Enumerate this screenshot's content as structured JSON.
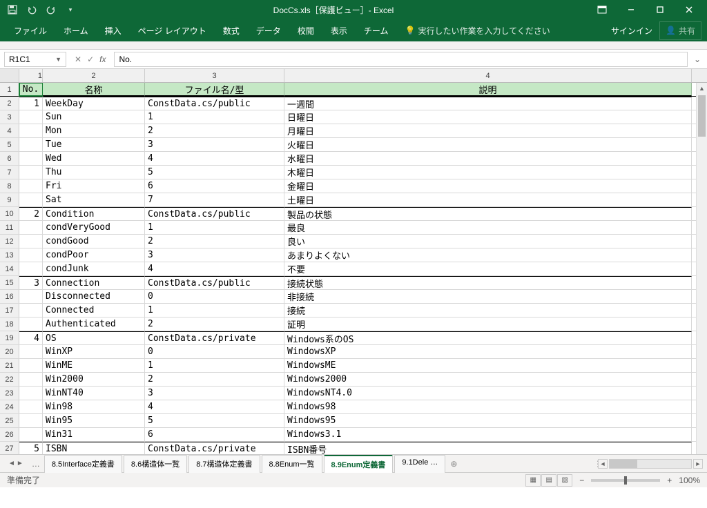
{
  "title": "DocCs.xls［保護ビュー］- Excel",
  "ribbon": {
    "tabs": [
      "ファイル",
      "ホーム",
      "挿入",
      "ページ レイアウト",
      "数式",
      "データ",
      "校閲",
      "表示",
      "チーム"
    ],
    "tell": "実行したい作業を入力してください",
    "signin": "サインイン",
    "share": "共有"
  },
  "namebox": "R1C1",
  "formula": "No.",
  "cols": [
    "1",
    "2",
    "3",
    "4"
  ],
  "headers": {
    "c1": "No.",
    "c2": "名称",
    "c3": "ファイル名/型",
    "c4": "説明"
  },
  "rows": [
    {
      "n": "1",
      "no": "1",
      "name": "WeekDay",
      "file": "ConstData.cs/public",
      "desc": "一週間",
      "top": true
    },
    {
      "n": "2",
      "no": "",
      "name": "Sun",
      "file": "1",
      "desc": "日曜日"
    },
    {
      "n": "3",
      "no": "",
      "name": "Mon",
      "file": "2",
      "desc": "月曜日"
    },
    {
      "n": "4",
      "no": "",
      "name": "Tue",
      "file": "3",
      "desc": "火曜日"
    },
    {
      "n": "5",
      "no": "",
      "name": "Wed",
      "file": "4",
      "desc": "水曜日"
    },
    {
      "n": "6",
      "no": "",
      "name": "Thu",
      "file": "5",
      "desc": "木曜日"
    },
    {
      "n": "7",
      "no": "",
      "name": "Fri",
      "file": "6",
      "desc": "金曜日"
    },
    {
      "n": "8",
      "no": "",
      "name": "Sat",
      "file": "7",
      "desc": "土曜日"
    },
    {
      "n": "9",
      "no": "2",
      "name": "Condition",
      "file": "ConstData.cs/public",
      "desc": "製品の状態",
      "top": true
    },
    {
      "n": "10",
      "no": "",
      "name": "condVeryGood",
      "file": "1",
      "desc": "最良"
    },
    {
      "n": "11",
      "no": "",
      "name": "condGood",
      "file": "2",
      "desc": "良い"
    },
    {
      "n": "12",
      "no": "",
      "name": "condPoor",
      "file": "3",
      "desc": "あまりよくない"
    },
    {
      "n": "13",
      "no": "",
      "name": "condJunk",
      "file": "4",
      "desc": "不要"
    },
    {
      "n": "14",
      "no": "3",
      "name": "Connection",
      "file": "ConstData.cs/public",
      "desc": "接続状態",
      "top": true
    },
    {
      "n": "15",
      "no": "",
      "name": "Disconnected",
      "file": "0",
      "desc": "非接続"
    },
    {
      "n": "16",
      "no": "",
      "name": "Connected",
      "file": "1",
      "desc": "接続"
    },
    {
      "n": "17",
      "no": "",
      "name": "Authenticated",
      "file": "2",
      "desc": "証明"
    },
    {
      "n": "18",
      "no": "4",
      "name": "OS",
      "file": "ConstData.cs/private",
      "desc": "Windows系のOS",
      "top": true
    },
    {
      "n": "19",
      "no": "",
      "name": "WinXP",
      "file": "0",
      "desc": "WindowsXP"
    },
    {
      "n": "20",
      "no": "",
      "name": "WinME",
      "file": "1",
      "desc": "WindowsME"
    },
    {
      "n": "21",
      "no": "",
      "name": "Win2000",
      "file": "2",
      "desc": "Windows2000"
    },
    {
      "n": "22",
      "no": "",
      "name": "WinNT40",
      "file": "3",
      "desc": "WindowsNT4.0"
    },
    {
      "n": "23",
      "no": "",
      "name": "Win98",
      "file": "4",
      "desc": "Windows98"
    },
    {
      "n": "24",
      "no": "",
      "name": "Win95",
      "file": "5",
      "desc": "Windows95"
    },
    {
      "n": "25",
      "no": "",
      "name": "Win31",
      "file": "6",
      "desc": "Windows3.1"
    },
    {
      "n": "26",
      "no": "5",
      "name": "ISBN",
      "file": "ConstData.cs/private",
      "desc": "ISBN番号",
      "top": true
    }
  ],
  "sheets": [
    "8.5Interface定義書",
    "8.6構造体一覧",
    "8.7構造体定義書",
    "8.8Enum一覧",
    "8.9Enum定義書",
    "9.1Dele …"
  ],
  "activeSheet": 4,
  "status": "準備完了",
  "zoom": "100%"
}
